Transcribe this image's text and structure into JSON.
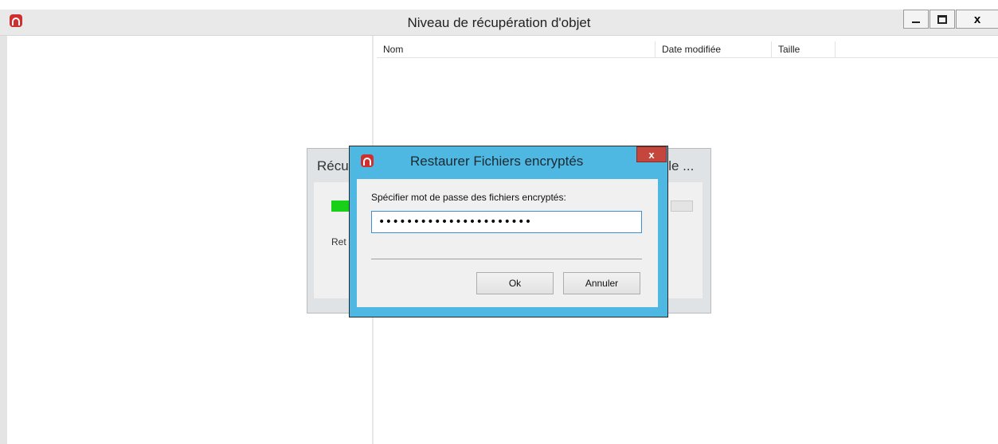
{
  "window": {
    "title": "Niveau  de récupération d'objet",
    "controls": {
      "minimize_icon": "minimize-icon",
      "maximize_icon": "maximize-icon",
      "close_label": "x"
    }
  },
  "file_list": {
    "columns": [
      "Nom",
      "Date modifiée",
      "Taille"
    ]
  },
  "background_dialog": {
    "title_left": "Récu",
    "title_right": "s le ...",
    "status_label": "Ret",
    "progress_color": "#17d017"
  },
  "password_dialog": {
    "title": "Restaurer Fichiers encryptés",
    "close_label": "x",
    "prompt": "Spécifier mot de passe des fichiers encryptés:",
    "password_masked": "••••••••••••••••••••••",
    "ok_label": "Ok",
    "cancel_label": "Annuler"
  },
  "colors": {
    "dialog_frame": "#4fb8e2",
    "close_button": "#c5463c",
    "app_logo": "#cf2f2f"
  }
}
